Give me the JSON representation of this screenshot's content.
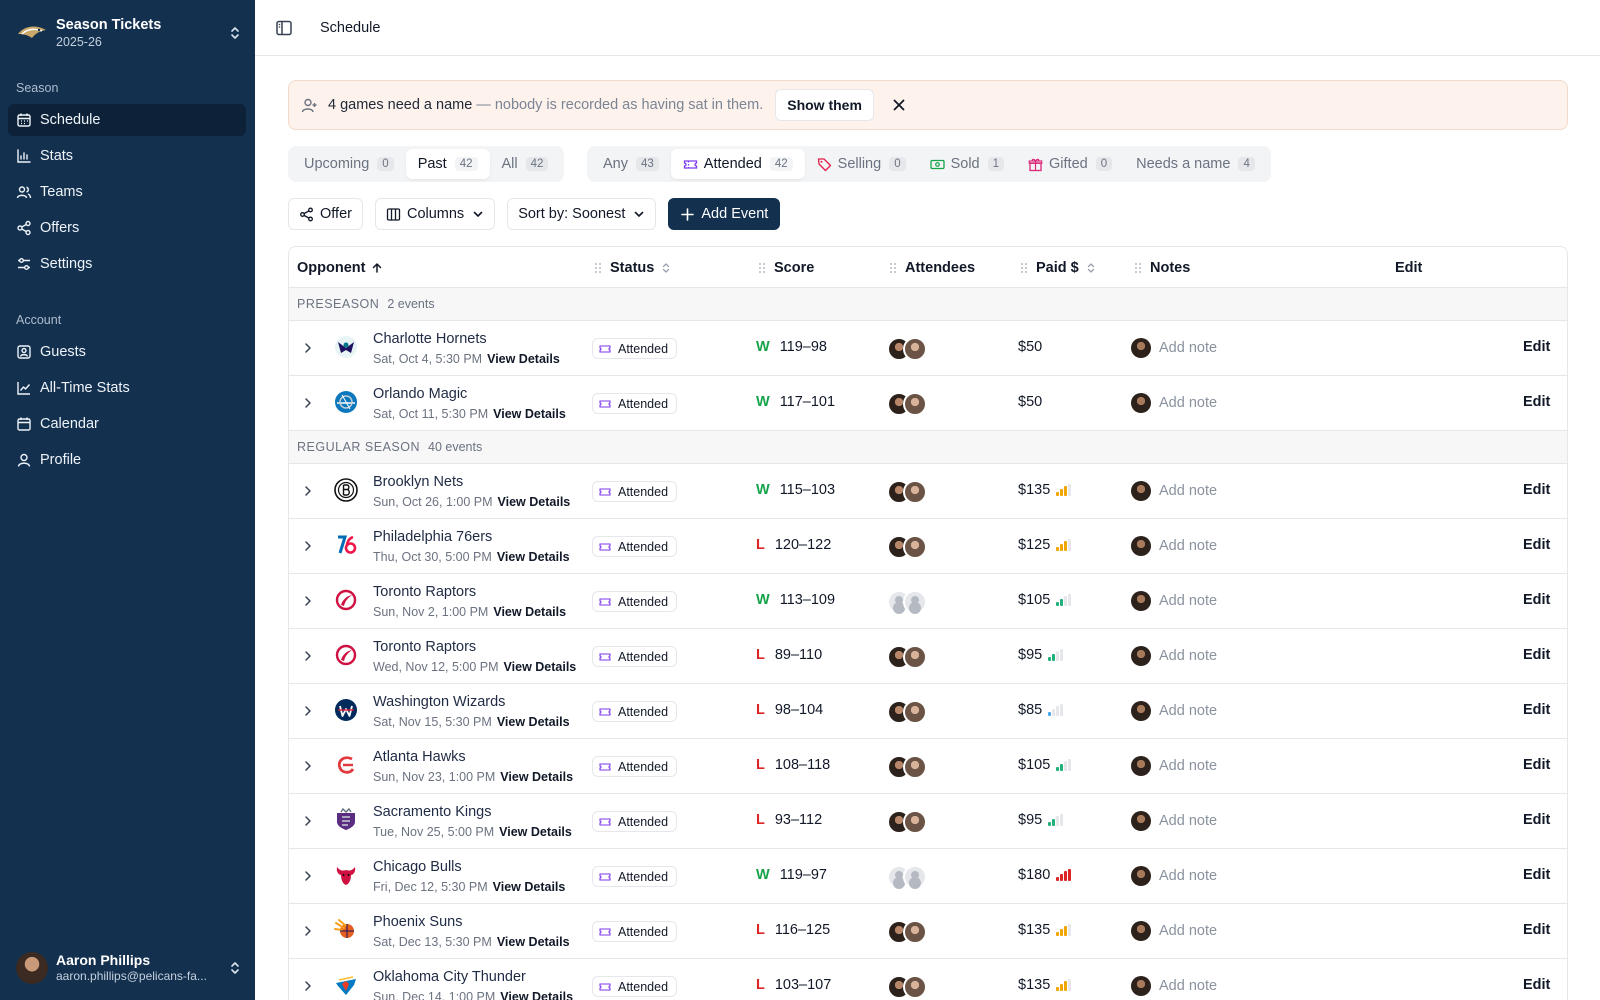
{
  "sidebar": {
    "brand_title": "Season Tickets",
    "brand_sub": "2025-26",
    "section_season": "Season",
    "section_account": "Account",
    "season_items": [
      {
        "label": "Schedule",
        "icon": "calendar-icon"
      },
      {
        "label": "Stats",
        "icon": "bar-chart-icon"
      },
      {
        "label": "Teams",
        "icon": "users-icon"
      },
      {
        "label": "Offers",
        "icon": "share-icon"
      },
      {
        "label": "Settings",
        "icon": "sliders-icon"
      }
    ],
    "account_items": [
      {
        "label": "Guests",
        "icon": "contact-icon"
      },
      {
        "label": "All-Time Stats",
        "icon": "line-chart-icon"
      },
      {
        "label": "Calendar",
        "icon": "calendar-icon"
      },
      {
        "label": "Profile",
        "icon": "user-icon"
      }
    ],
    "user_name": "Aaron Phillips",
    "user_email": "aaron.phillips@pelicans-fa..."
  },
  "header": {
    "title": "Schedule"
  },
  "banner": {
    "strong": "4 games need a name",
    "muted": "— nobody is recorded as having sat in them.",
    "button": "Show them"
  },
  "time_filter": [
    {
      "label": "Upcoming",
      "count": "0"
    },
    {
      "label": "Past",
      "count": "42"
    },
    {
      "label": "All",
      "count": "42"
    }
  ],
  "status_filter": [
    {
      "label": "Any",
      "count": "43"
    },
    {
      "label": "Attended",
      "count": "42"
    },
    {
      "label": "Selling",
      "count": "0"
    },
    {
      "label": "Sold",
      "count": "1"
    },
    {
      "label": "Gifted",
      "count": "0"
    },
    {
      "label": "Needs a name",
      "count": "4"
    }
  ],
  "toolbar": {
    "offer": "Offer",
    "columns": "Columns",
    "sort": "Sort by: Soonest",
    "add_event": "Add Event"
  },
  "table": {
    "columns": [
      "Opponent",
      "Status",
      "Score",
      "Attendees",
      "Paid $",
      "Notes",
      "Edit"
    ],
    "view_details": "View Details",
    "add_note": "Add note",
    "edit": "Edit",
    "status_label": "Attended",
    "groups": [
      {
        "name": "PRESEASON",
        "count": "2 events"
      },
      {
        "name": "REGULAR SEASON",
        "count": "40 events"
      }
    ],
    "rows": [
      {
        "opponent": "Charlotte Hornets",
        "date": "Sat, Oct 4, 5:30 PM",
        "result": "W",
        "score": "119–98",
        "paid": "$50",
        "attendees": "photos"
      },
      {
        "opponent": "Orlando Magic",
        "date": "Sat, Oct 11, 5:30 PM",
        "result": "W",
        "score": "117–101",
        "paid": "$50",
        "attendees": "photos"
      },
      {
        "opponent": "Brooklyn Nets",
        "date": "Sun, Oct 26, 1:00 PM",
        "result": "W",
        "score": "115–103",
        "paid": "$135",
        "attendees": "photos",
        "price_level": 3
      },
      {
        "opponent": "Philadelphia 76ers",
        "date": "Thu, Oct 30, 5:00 PM",
        "result": "L",
        "score": "120–122",
        "paid": "$125",
        "attendees": "photos",
        "price_level": 3
      },
      {
        "opponent": "Toronto Raptors",
        "date": "Sun, Nov 2, 1:00 PM",
        "result": "W",
        "score": "113–109",
        "paid": "$105",
        "attendees": "placeholder",
        "price_level": 2
      },
      {
        "opponent": "Toronto Raptors",
        "date": "Wed, Nov 12, 5:00 PM",
        "result": "L",
        "score": "89–110",
        "paid": "$95",
        "attendees": "photos",
        "price_level": 2
      },
      {
        "opponent": "Washington Wizards",
        "date": "Sat, Nov 15, 5:30 PM",
        "result": "L",
        "score": "98–104",
        "paid": "$85",
        "attendees": "photos",
        "price_level": 1
      },
      {
        "opponent": "Atlanta Hawks",
        "date": "Sun, Nov 23, 1:00 PM",
        "result": "L",
        "score": "108–118",
        "paid": "$105",
        "attendees": "photos",
        "price_level": 2
      },
      {
        "opponent": "Sacramento Kings",
        "date": "Tue, Nov 25, 5:00 PM",
        "result": "L",
        "score": "93–112",
        "paid": "$95",
        "attendees": "photos",
        "price_level": 2
      },
      {
        "opponent": "Chicago Bulls",
        "date": "Fri, Dec 12, 5:30 PM",
        "result": "W",
        "score": "119–97",
        "paid": "$180",
        "attendees": "placeholder",
        "price_level": 4
      },
      {
        "opponent": "Phoenix Suns",
        "date": "Sat, Dec 13, 5:30 PM",
        "result": "L",
        "score": "116–125",
        "paid": "$135",
        "attendees": "photos",
        "price_level": 3
      },
      {
        "opponent": "Oklahoma City Thunder",
        "date": "Sun, Dec 14, 1:00 PM",
        "result": "L",
        "score": "103–107",
        "paid": "$135",
        "attendees": "photos",
        "price_level": 3
      }
    ]
  },
  "colors": {
    "sidebar": "#13304f",
    "active_nav": "#0d2238",
    "win": "#16a34a",
    "loss": "#dc2626",
    "price_high": "#dc2626",
    "price_mid": "#f0a500",
    "price_low": "#22b07a",
    "price_lowest": "#4aa8e8"
  }
}
